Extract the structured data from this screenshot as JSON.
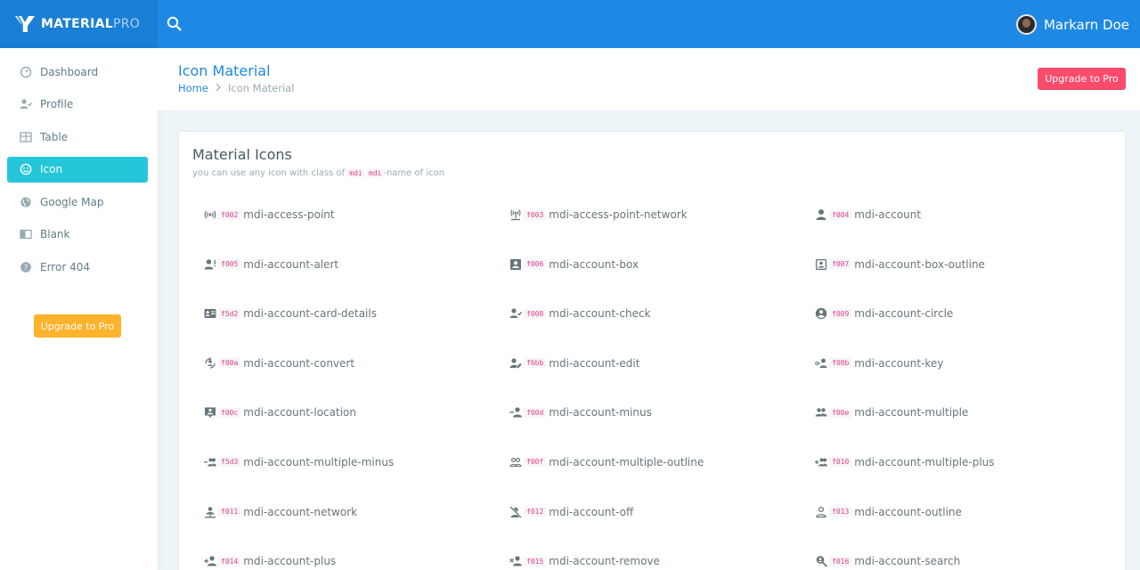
{
  "brand": {
    "name_bold": "MATERIAL",
    "name_light": "PRO"
  },
  "user": {
    "name": "Markarn Doe"
  },
  "sidebar": {
    "items": [
      {
        "label": "Dashboard",
        "icon": "gauge-icon",
        "active": false
      },
      {
        "label": "Profile",
        "icon": "account-check-icon",
        "active": false
      },
      {
        "label": "Table",
        "icon": "table-icon",
        "active": false
      },
      {
        "label": "Icon",
        "icon": "emoticon-icon",
        "active": true
      },
      {
        "label": "Google Map",
        "icon": "earth-icon",
        "active": false
      },
      {
        "label": "Blank",
        "icon": "book-open-icon",
        "active": false
      },
      {
        "label": "Error 404",
        "icon": "help-circle-icon",
        "active": false
      }
    ],
    "upgrade_label": "Upgrade to Pro"
  },
  "header": {
    "title": "Icon Material",
    "breadcrumb_home": "Home",
    "breadcrumb_current": "Icon Material",
    "upgrade_label": "Upgrade to Pro"
  },
  "card": {
    "title": "Material Icons",
    "subtitle_pre": "you can use any icon with class of ",
    "subtitle_code1": "mdi",
    "subtitle_code2": "mdi",
    "subtitle_post": "-name of icon"
  },
  "icons": [
    {
      "code": "f002",
      "name": "mdi-access-point",
      "icon": "access-point-icon"
    },
    {
      "code": "f003",
      "name": "mdi-access-point-network",
      "icon": "access-point-network-icon"
    },
    {
      "code": "f004",
      "name": "mdi-account",
      "icon": "account-icon"
    },
    {
      "code": "f005",
      "name": "mdi-account-alert",
      "icon": "account-alert-icon"
    },
    {
      "code": "f006",
      "name": "mdi-account-box",
      "icon": "account-box-icon"
    },
    {
      "code": "f007",
      "name": "mdi-account-box-outline",
      "icon": "account-box-outline-icon"
    },
    {
      "code": "f5d2",
      "name": "mdi-account-card-details",
      "icon": "account-card-details-icon"
    },
    {
      "code": "f008",
      "name": "mdi-account-check",
      "icon": "account-check-icon"
    },
    {
      "code": "f009",
      "name": "mdi-account-circle",
      "icon": "account-circle-icon"
    },
    {
      "code": "f00a",
      "name": "mdi-account-convert",
      "icon": "account-convert-icon"
    },
    {
      "code": "f6bb",
      "name": "mdi-account-edit",
      "icon": "account-edit-icon"
    },
    {
      "code": "f00b",
      "name": "mdi-account-key",
      "icon": "account-key-icon"
    },
    {
      "code": "f00c",
      "name": "mdi-account-location",
      "icon": "account-location-icon"
    },
    {
      "code": "f00d",
      "name": "mdi-account-minus",
      "icon": "account-minus-icon"
    },
    {
      "code": "f00e",
      "name": "mdi-account-multiple",
      "icon": "account-multiple-icon"
    },
    {
      "code": "f5d3",
      "name": "mdi-account-multiple-minus",
      "icon": "account-multiple-minus-icon"
    },
    {
      "code": "f00f",
      "name": "mdi-account-multiple-outline",
      "icon": "account-multiple-outline-icon"
    },
    {
      "code": "f010",
      "name": "mdi-account-multiple-plus",
      "icon": "account-multiple-plus-icon"
    },
    {
      "code": "f011",
      "name": "mdi-account-network",
      "icon": "account-network-icon"
    },
    {
      "code": "f012",
      "name": "mdi-account-off",
      "icon": "account-off-icon"
    },
    {
      "code": "f013",
      "name": "mdi-account-outline",
      "icon": "account-outline-icon"
    },
    {
      "code": "f014",
      "name": "mdi-account-plus",
      "icon": "account-plus-icon"
    },
    {
      "code": "f015",
      "name": "mdi-account-remove",
      "icon": "account-remove-icon"
    },
    {
      "code": "f016",
      "name": "mdi-account-search",
      "icon": "account-search-icon"
    }
  ],
  "colors": {
    "topbar": "#1e88e5",
    "active_nav": "#26c6da",
    "upgrade_side": "#ffb22b",
    "upgrade_top": "#fc4b6c",
    "code_text": "#e83e8c"
  }
}
